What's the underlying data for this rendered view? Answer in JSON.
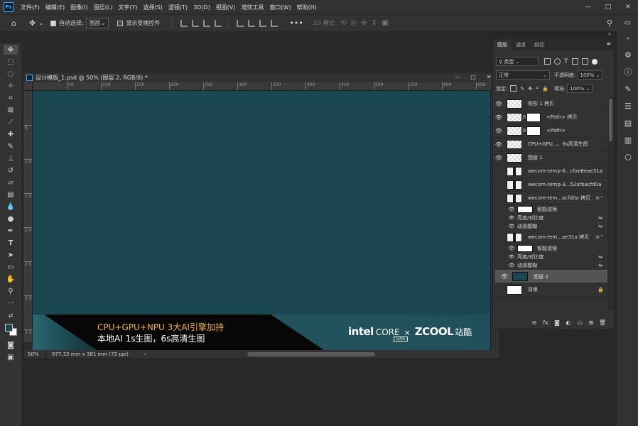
{
  "menubar": {
    "app_icon": "Ps",
    "items": [
      "文件(F)",
      "编辑(E)",
      "图像(I)",
      "图层(L)",
      "文字(Y)",
      "选择(S)",
      "滤镜(T)",
      "3D(D)",
      "视图(V)",
      "增效工具",
      "窗口(W)",
      "帮助(H)"
    ],
    "window_controls": [
      "—",
      "□",
      "✕"
    ]
  },
  "options": {
    "auto_select_label": "自动选择:",
    "auto_select_value": "图层",
    "show_transform_label": "显示变换控件",
    "mode_3d_label": "3D 模式:"
  },
  "document": {
    "title": "设计模版_1.psd @ 50% (图层 2, RGB/8) *",
    "ruler_marks": [
      "50",
      "100",
      "150",
      "200",
      "250",
      "300",
      "350",
      "400",
      "450",
      "500",
      "550",
      "600",
      "650"
    ],
    "vruler_marks": [
      "5",
      "1\n0",
      "1\n5",
      "2\n0",
      "2\n5",
      "3\n0",
      "3\n5"
    ],
    "zoom": "50%",
    "dimensions": "677.33 mm x 381 mm (72 ppi)",
    "status_arrow": "›"
  },
  "banner": {
    "line1": "CPU+GPU+NPU 3大AI引擎加持",
    "line2": "本地AI 1s生图，6s高清生图",
    "intel": "intel",
    "core": "CORE",
    "ultra": "ULTRA",
    "times": "×",
    "zcool": "ZCOOL",
    "zhanku": "站酷"
  },
  "layers_panel": {
    "tabs": [
      "图层",
      "通道",
      "路径"
    ],
    "filter_label": "类型",
    "blend_mode": "正常",
    "opacity_label": "不透明度:",
    "opacity_value": "100%",
    "lock_label": "锁定:",
    "fill_label": "填充:",
    "fill_value": "100%",
    "layers": [
      {
        "name": "矩形 1 拷贝",
        "visible": true,
        "thumb": "checker"
      },
      {
        "name": "<Path> 拷贝",
        "visible": true,
        "thumb": "checker",
        "mask": true
      },
      {
        "name": "<Path>",
        "visible": true,
        "thumb": "checker",
        "mask": true
      },
      {
        "name": "CPU+GPU...，6s高清生图",
        "visible": true,
        "thumb": "checker"
      },
      {
        "name": "图层 1",
        "visible": true,
        "thumb": "checker"
      },
      {
        "name": "wecom-temp-6...cfae6eae31a",
        "visible": false,
        "thumb": "img"
      },
      {
        "name": "wecom-temp-3...52afbacfd0a",
        "visible": false,
        "thumb": "img"
      },
      {
        "name": "wecom-tem...acfd0a 拷贝",
        "visible": false,
        "thumb": "img"
      },
      {
        "name": "wecom-tem...ae31a 拷贝",
        "visible": false,
        "thumb": "img"
      },
      {
        "name": "图层 2",
        "visible": true,
        "thumb": "dark",
        "selected": true
      },
      {
        "name": "背景",
        "visible": false,
        "thumb": "white"
      }
    ],
    "smart_filters_a": {
      "label": "智能滤镜",
      "f1": "亮度/对比度",
      "f2": "动感模糊"
    },
    "smart_filters_b": {
      "label": "智能滤镜",
      "f1": "亮度/对比度",
      "f2": "动感模糊"
    },
    "lock_icon": "🔒"
  },
  "colors": {
    "canvas": "#1a4750",
    "accent": "#31a8ff",
    "banner_gold": "#f2b234"
  }
}
